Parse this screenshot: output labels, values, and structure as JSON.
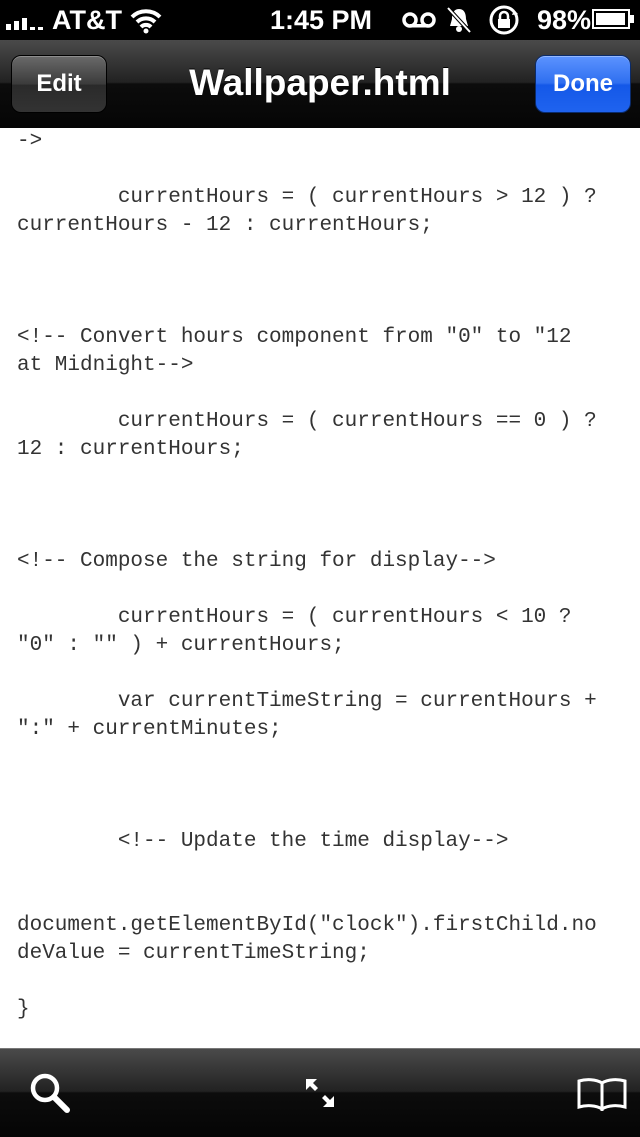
{
  "status_bar": {
    "carrier": "AT&T",
    "time": "1:45 PM",
    "battery": "98%",
    "battery_level": 0.98
  },
  "nav": {
    "edit_label": "Edit",
    "title": "Wallpaper.html",
    "done_label": "Done"
  },
  "document": {
    "lines": [
      "->",
      "",
      "        currentHours = ( currentHours > 12 ) ?",
      "currentHours - 12 : currentHours;",
      "",
      "",
      "",
      "<!-- Convert hours component from \"0\" to \"12",
      "at Midnight-->",
      "",
      "        currentHours = ( currentHours == 0 ) ?",
      "12 : currentHours;",
      "",
      "",
      "",
      "<!-- Compose the string for display-->",
      "",
      "        currentHours = ( currentHours < 10 ?",
      "\"0\" : \"\" ) + currentHours;",
      "",
      "        var currentTimeString = currentHours +",
      "\":\" + currentMinutes;",
      "",
      "",
      "",
      "        <!-- Update the time display-->",
      "",
      "",
      "document.getElementById(\"clock\").firstChild.no",
      "deValue = currentTimeString;",
      "",
      "}"
    ]
  },
  "toolbar": {
    "icons": [
      "search-icon",
      "expand-icon",
      "bookmarks-icon"
    ]
  }
}
